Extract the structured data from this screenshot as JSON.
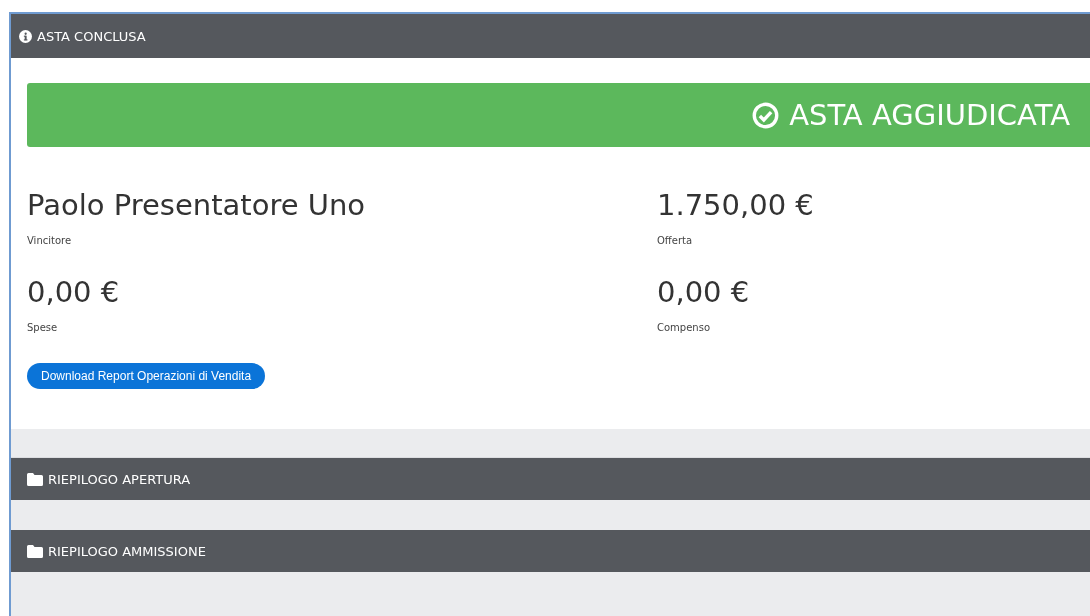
{
  "panel": {
    "title": "ASTA CONCLUSA",
    "status": {
      "kind": "success",
      "text": "ASTA AGGIUDICATA"
    },
    "fields": [
      {
        "value": "Paolo Presentatore Uno",
        "label": "Vincitore"
      },
      {
        "value": "1.750,00 €",
        "label": "Offerta"
      },
      {
        "value": "0,00 €",
        "label": "Spese"
      },
      {
        "value": "0,00 €",
        "label": "Compenso"
      }
    ],
    "button": "Download Report Operazioni di Vendita"
  },
  "sections": [
    {
      "title": "RIEPILOGO APERTURA"
    },
    {
      "title": "RIEPILOGO AMMISSIONE"
    }
  ]
}
